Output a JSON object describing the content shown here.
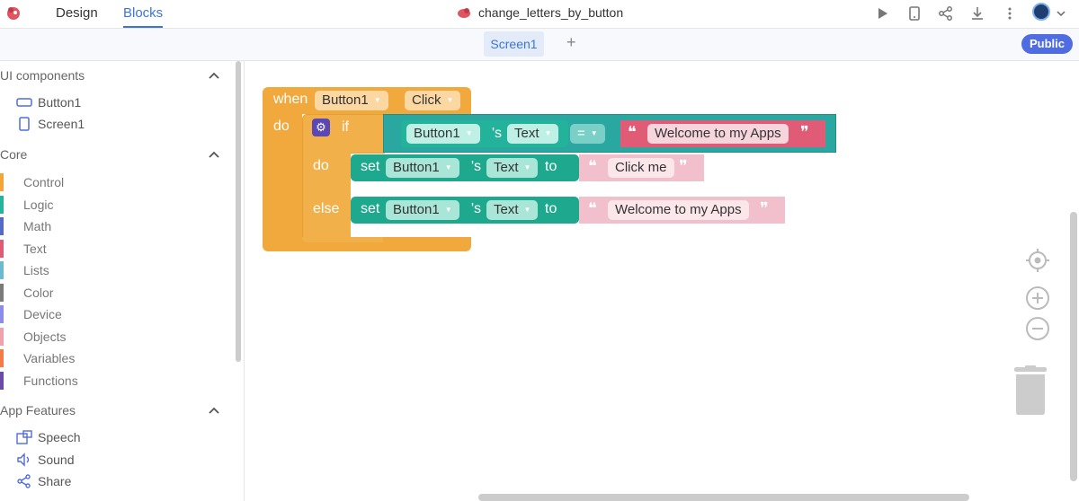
{
  "header": {
    "tabs": [
      {
        "label": "Design"
      },
      {
        "label": "Blocks"
      }
    ],
    "project_name": "change_letters_by_button"
  },
  "screenbar": {
    "screen_tab": "Screen1",
    "add_label": "+",
    "public_label": "Public"
  },
  "sidebar": {
    "ui_components": {
      "title": "UI components",
      "items": [
        {
          "label": "Button1"
        },
        {
          "label": "Screen1"
        }
      ]
    },
    "core": {
      "title": "Core",
      "items": [
        {
          "label": "Control",
          "color": "#f4a53a"
        },
        {
          "label": "Logic",
          "color": "#26b39b"
        },
        {
          "label": "Math",
          "color": "#5569c7"
        },
        {
          "label": "Text",
          "color": "#e05b76"
        },
        {
          "label": "Lists",
          "color": "#6bbad0"
        },
        {
          "label": "Color",
          "color": "#7a7a7a"
        },
        {
          "label": "Device",
          "color": "#8b8be8"
        },
        {
          "label": "Objects",
          "color": "#f2a1ae"
        },
        {
          "label": "Variables",
          "color": "#f47b45"
        },
        {
          "label": "Functions",
          "color": "#6a4ca8"
        }
      ]
    },
    "app_features": {
      "title": "App Features",
      "items": [
        {
          "label": "Speech"
        },
        {
          "label": "Sound"
        },
        {
          "label": "Share"
        }
      ]
    }
  },
  "blocks": {
    "when": "when",
    "event_component": "Button1",
    "event_name": "Click",
    "do": "do",
    "if": "if",
    "if_component": "Button1",
    "possessive": "'s",
    "if_property": "Text",
    "operator": "=",
    "compare_text": "Welcome to my Apps",
    "then_label": "do",
    "else_label": "else",
    "set1": {
      "set": "set",
      "component": "Button1",
      "possessive": "'s",
      "property": "Text",
      "to": "to",
      "value": "Click me"
    },
    "set2": {
      "set": "set",
      "component": "Button1",
      "possessive": "'s",
      "property": "Text",
      "to": "to",
      "value": "Welcome to my Apps"
    },
    "open_quote": "❝",
    "close_quote": "❞"
  },
  "colors": {
    "event": "#f1a83d",
    "component": "#1ea88e",
    "text": "#f2bfcc",
    "compare_text": "#e05b76",
    "accent": "#3b74e0"
  }
}
